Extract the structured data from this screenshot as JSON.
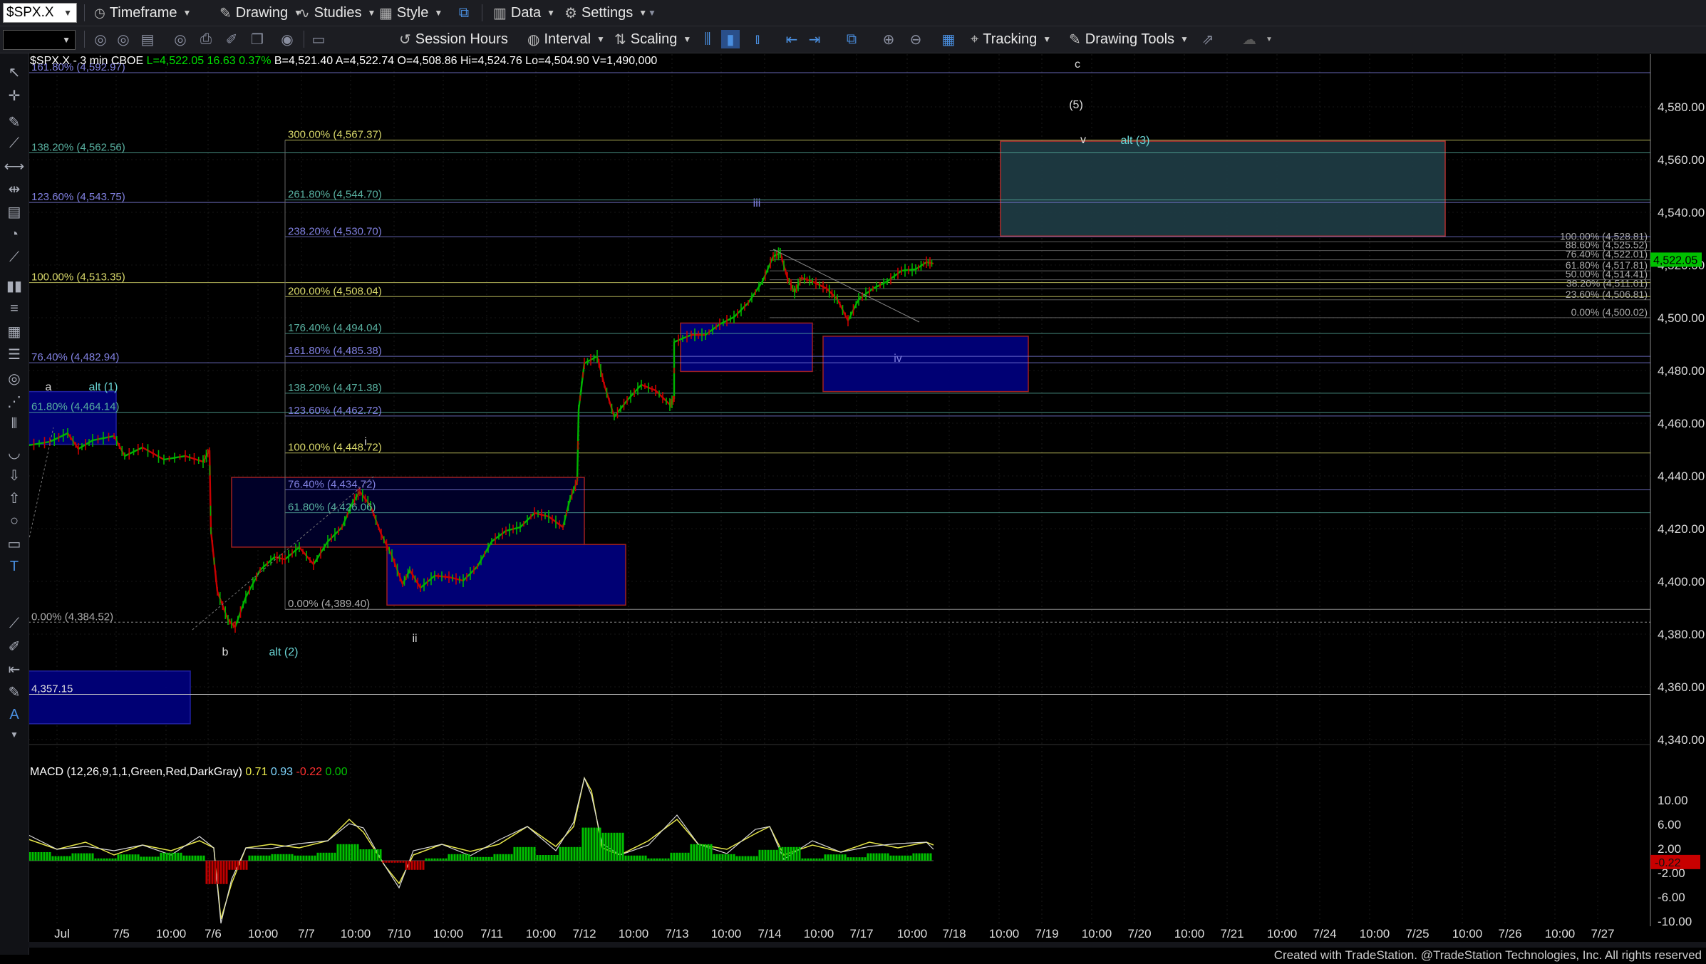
{
  "toolbar": {
    "symbol": "$SPX.X",
    "timeframe": "Timeframe",
    "drawing": "Drawing",
    "studies": "Studies",
    "style": "Style",
    "data": "Data",
    "settings": "Settings",
    "session_hours": "Session Hours",
    "interval": "Interval",
    "scaling": "Scaling",
    "tracking": "Tracking",
    "drawing_tools": "Drawing Tools"
  },
  "header": {
    "title": "$SPX.X - 3 min  CBOE",
    "last": "L=4,522.05",
    "change": "16.63",
    "change_pct": "0.37%",
    "rest": "B=4,521.40  A=4,522.74  O=4,508.86  Hi=4,524.76  Lo=4,504.90  V=1,490,000"
  },
  "price_axis": {
    "ticks": [
      "4,580.00",
      "4,560.00",
      "4,540.00",
      "4,520.00",
      "4,500.00",
      "4,480.00",
      "4,460.00",
      "4,440.00",
      "4,420.00",
      "4,400.00",
      "4,380.00",
      "4,360.00",
      "4,340.00"
    ],
    "current_price": "4,522.05"
  },
  "time_axis": {
    "labels": [
      "Jul",
      "7/5",
      "10:00",
      "7/6",
      "10:00",
      "7/7",
      "10:00",
      "7/10",
      "10:00",
      "7/11",
      "10:00",
      "7/12",
      "10:00",
      "7/13",
      "10:00",
      "7/14",
      "10:00",
      "7/17",
      "10:00",
      "7/18",
      "10:00",
      "7/19",
      "10:00",
      "7/20",
      "10:00",
      "7/21",
      "10:00",
      "7/24",
      "10:00",
      "7/25",
      "10:00",
      "7/26",
      "10:00",
      "7/27"
    ]
  },
  "fib_labels": [
    "161.80% (4,592.97)",
    "138.20% (4,562.56)",
    "123.60% (4,543.75)",
    "100.00% (4,513.35)",
    "76.40% (4,482.94)",
    "61.80% (4,464.14)",
    "0.00% (4,384.52)",
    "300.00% (4,567.37)",
    "261.80% (4,544.70)",
    "238.20% (4,530.70)",
    "200.00% (4,508.04)",
    "176.40% (4,494.04)",
    "161.80% (4,485.38)",
    "138.20% (4,471.38)",
    "123.60% (4,462.72)",
    "100.00% (4,448.72)",
    "76.40% (4,434.72)",
    "61.80% (4,426.06)",
    "0.00% (4,389.40)",
    "100.00% (4,528.81)",
    "88.60% (4,525.52)",
    "76.40% (4,522.01)",
    "61.80% (4,517.81)",
    "50.00% (4,514.41)",
    "38.20% (4,511.01)",
    "23.60% (4,506.81)",
    "0.00% (4,500.02)",
    "4,357.15"
  ],
  "wave_labels": [
    "a",
    "alt (1)",
    "b",
    "alt (2)",
    "i",
    "ii",
    "iii",
    "iv",
    "v",
    "alt (3)",
    "(5)",
    "c"
  ],
  "macd": {
    "label": "MACD (12,26,9,1,1,Green,Red,DarkGray)",
    "v1": "0.71",
    "v2": "0.93",
    "v3": "-0.22",
    "v4": "0.00",
    "ticks": [
      "10.00",
      "6.00",
      "2.00",
      "-2.00",
      "-6.00",
      "-10.00"
    ],
    "current": "-0.22"
  },
  "colors": {
    "background": "#000000",
    "fib_yellow": "#d8d86a",
    "fib_teal": "#58b0a0",
    "fib_blue": "#8080e0",
    "box_blue": "#00007a",
    "box_border": "#b03030",
    "label_teal": "#6ad6d6",
    "price_green": "#00c000",
    "up": "#00b400",
    "down": "#c80000"
  },
  "footer": "Created with TradeStation. @TradeStation Technologies, Inc. All rights reserved"
}
